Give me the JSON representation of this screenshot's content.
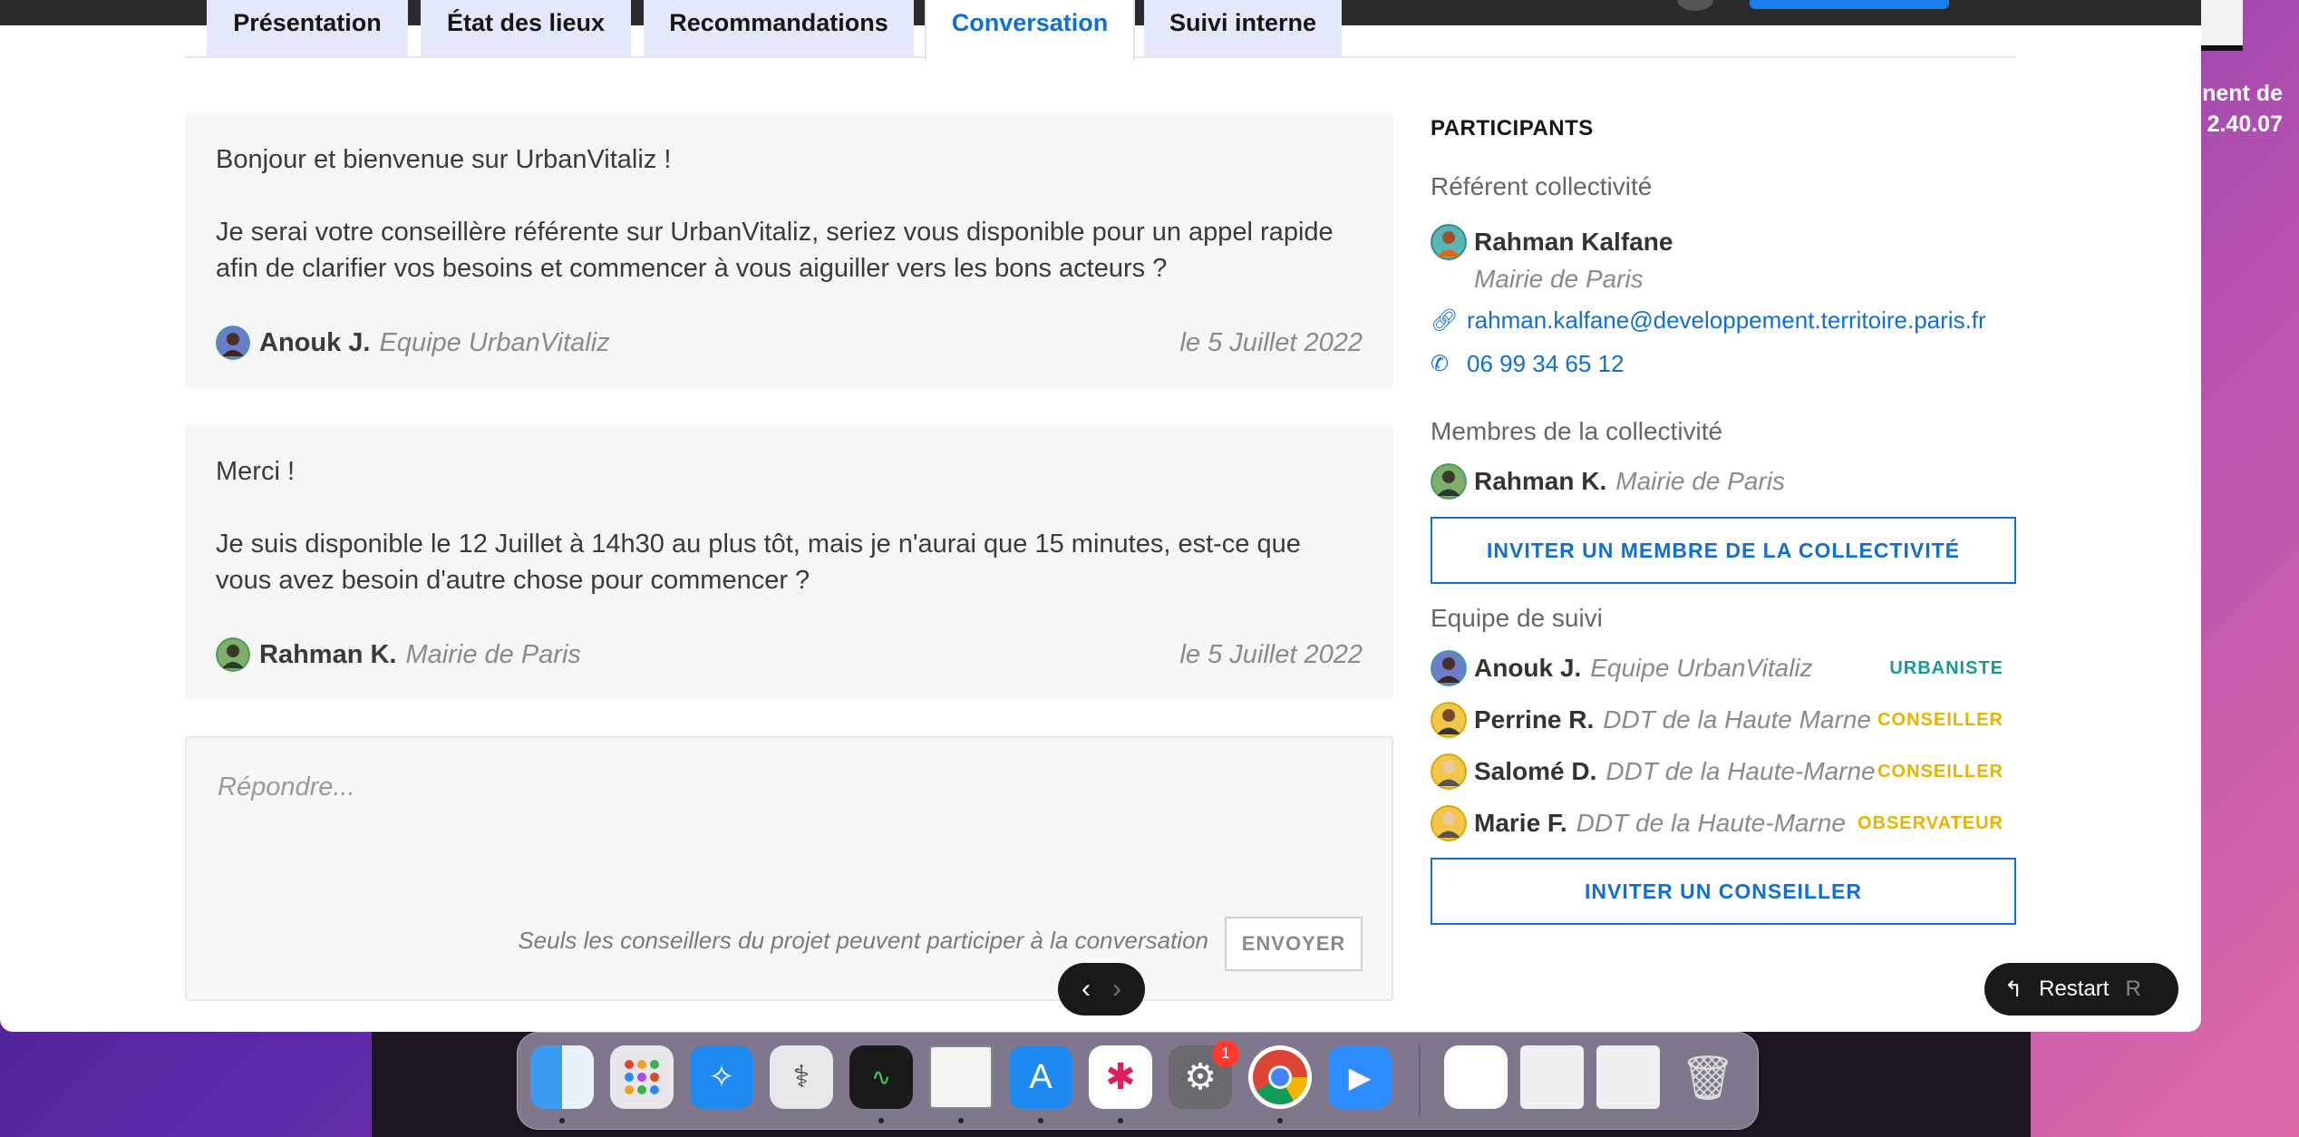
{
  "desktop": {
    "right_text_line1": "nent de",
    "right_text_line2": "2.40.07"
  },
  "tabs": [
    "Présentation",
    "État des lieux",
    "Recommandations",
    "Conversation",
    "Suivi interne"
  ],
  "messages": [
    {
      "para1": "Bonjour et bienvenue sur UrbanVitaliz !",
      "para2": "Je serai votre conseillère référente sur UrbanVitaliz, seriez vous disponible pour un appel rapide afin de clarifier vos besoins et commencer à vous aiguiller vers les bons acteurs ?",
      "author": "Anouk J.",
      "org": "Equipe UrbanVitaliz",
      "date": "le 5 Juillet 2022"
    },
    {
      "para1": "Merci !",
      "para2": "Je suis disponible le 12 Juillet à 14h30 au plus tôt, mais je n'aurai que 15 minutes, est-ce que vous avez besoin d'autre chose pour commencer ?",
      "author": "Rahman K.",
      "org": "Mairie de Paris",
      "date": "le 5 Juillet 2022"
    }
  ],
  "reply": {
    "placeholder": "Répondre...",
    "note": "Seuls les conseillers du projet peuvent participer à la conversation",
    "send_label": "ENVOYER"
  },
  "participants": {
    "title": "PARTICIPANTS",
    "referent_section": "Référent collectivité",
    "referent_name": "Rahman Kalfane",
    "referent_org": "Mairie de Paris",
    "referent_email": "rahman.kalfane@developpement.territoire.paris.fr",
    "referent_phone": "06 99 34 65 12",
    "members_section": "Membres de la collectivité",
    "members": [
      {
        "name": "Rahman K.",
        "org": "Mairie de Paris"
      }
    ],
    "invite_member_label": "INVITER UN MEMBRE DE LA COLLECTIVITÉ",
    "team_section": "Equipe de suivi",
    "team": [
      {
        "name": "Anouk J.",
        "org": "Equipe UrbanVitaliz",
        "role": "URBANISTE",
        "role_color": "#169b9b"
      },
      {
        "name": "Perrine R.",
        "org": "DDT de la Haute Marne",
        "role": "CONSEILLER",
        "role_color": "#e6b400"
      },
      {
        "name": "Salomé D.",
        "org": "DDT de la Haute-Marne",
        "role": "CONSEILLER",
        "role_color": "#e6b400"
      },
      {
        "name": "Marie F.",
        "org": "DDT de la Haute-Marne",
        "role": "OBSERVATEUR",
        "role_color": "#e6b400"
      }
    ],
    "invite_advisor_label": "INVITER UN CONSEILLER"
  },
  "nav": {
    "prev": "‹",
    "next": "›"
  },
  "restart": {
    "label": "Restart",
    "key": "R",
    "icon": "↰"
  },
  "dock": {
    "badge_count": "1"
  },
  "colors": {
    "accent": "#0f6fd6",
    "tab_bg": "#e3e9fb",
    "urbaniste": "#169b9b",
    "conseiller": "#e6b400"
  }
}
